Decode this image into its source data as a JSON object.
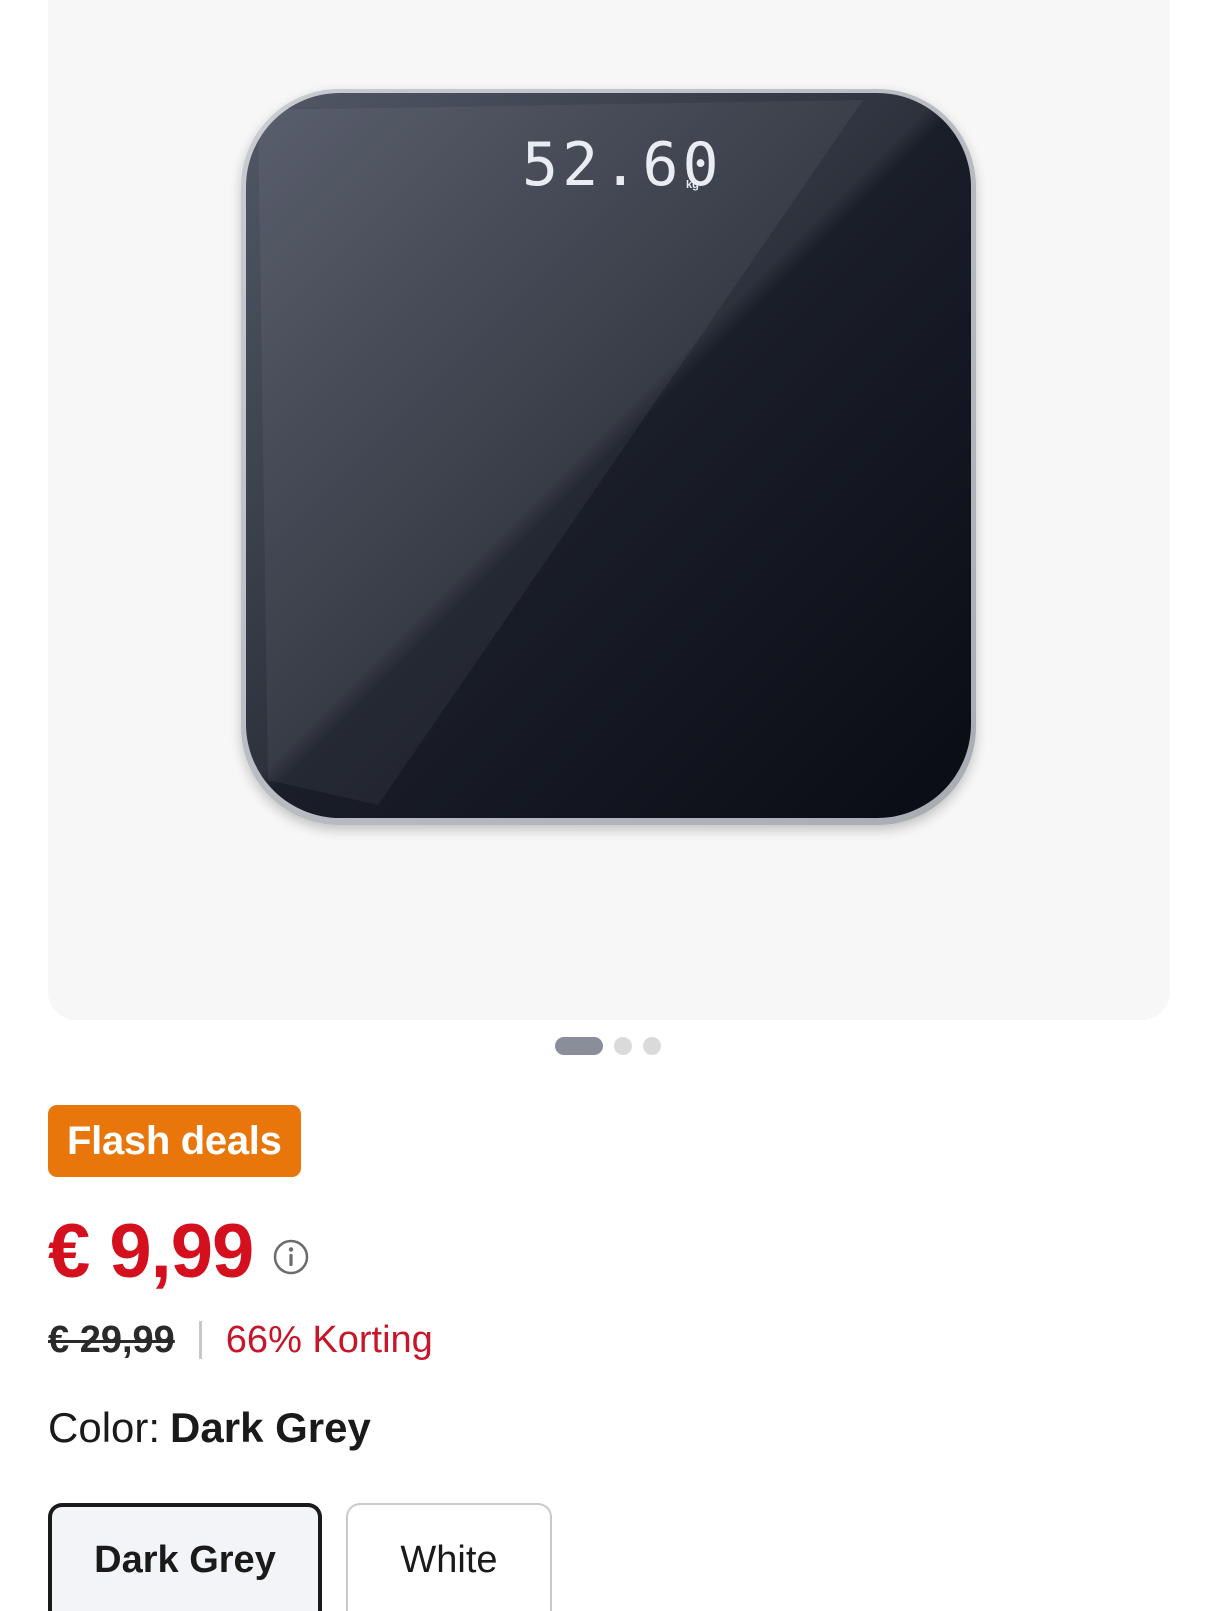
{
  "product_image": {
    "display_reading": "52.60",
    "display_unit": "kg",
    "scale_color": "#1f2330"
  },
  "carousel": {
    "total_slides": 3,
    "active_index": 0
  },
  "badge": {
    "label": "Flash deals",
    "color": "#e8760a"
  },
  "pricing": {
    "current_price": "€ 9,99",
    "original_price": "€ 29,99",
    "discount_label": "66% Korting",
    "price_color": "#d4101e"
  },
  "color_selector": {
    "label": "Color:",
    "selected_value": "Dark Grey",
    "options": [
      {
        "label": "Dark Grey",
        "selected": true
      },
      {
        "label": "White",
        "selected": false
      }
    ]
  }
}
